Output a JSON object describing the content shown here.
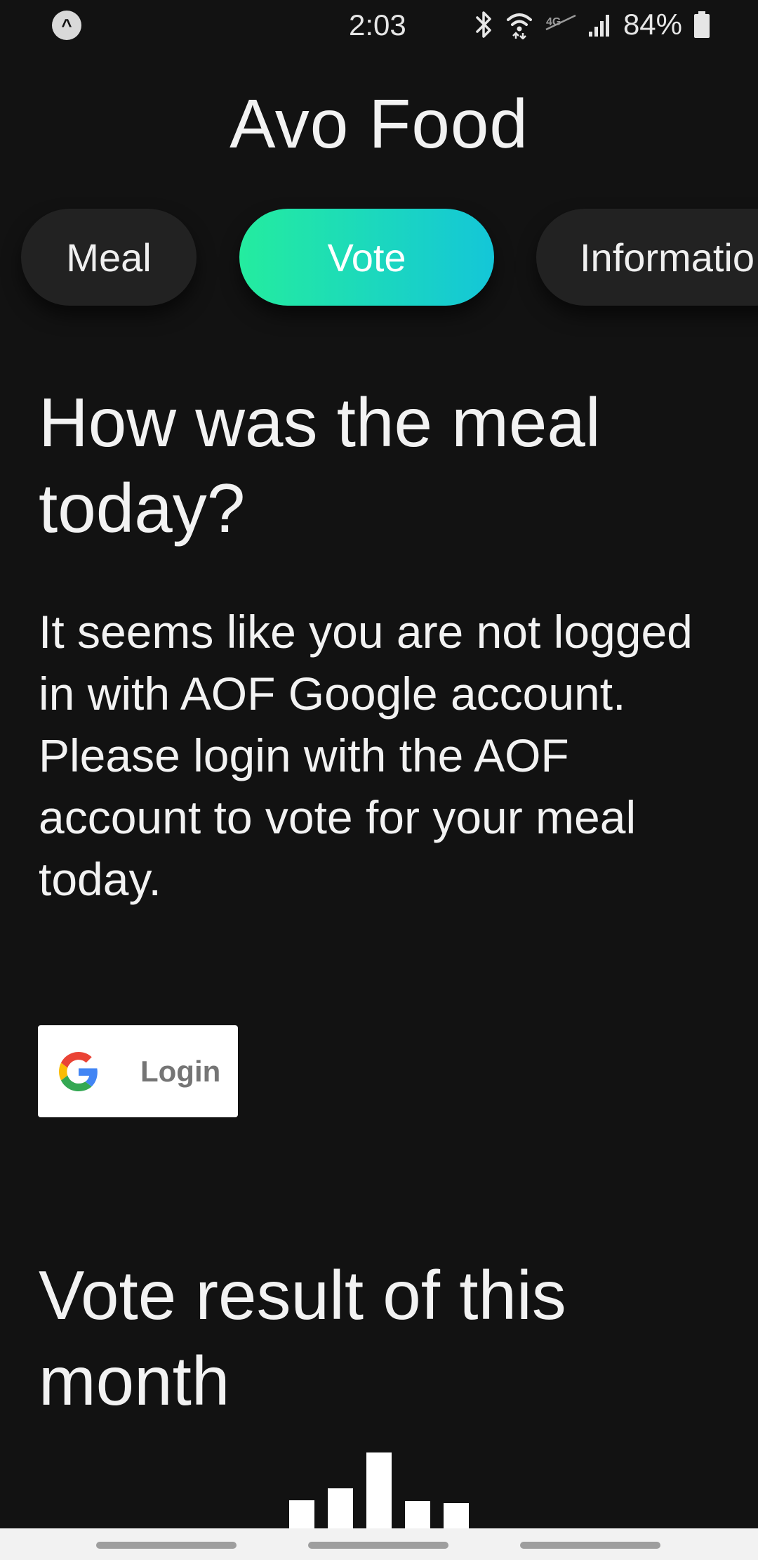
{
  "status_bar": {
    "time": "2:03",
    "battery": "84%"
  },
  "app": {
    "title": "Avo Food"
  },
  "tabs": [
    {
      "label": "Meal",
      "active": false
    },
    {
      "label": "Vote",
      "active": true
    },
    {
      "label": "Informatio",
      "active": false
    }
  ],
  "colors": {
    "background": "#121212",
    "tab_gradient_start": "#24ec9f",
    "tab_gradient_end": "#14c6d8"
  },
  "content": {
    "meal_heading": "How was the meal today?",
    "login_message_line1": "It seems like you are not logged in with AOF Google account.",
    "login_message_line2": "Please login with the AOF account to vote for your meal today.",
    "login_button_label": "Login",
    "vote_heading": "Vote result of this month"
  },
  "icons": {
    "status_app": "app-launcher-icon",
    "bluetooth": "bluetooth-icon",
    "wifi": "wifi-icon",
    "signal": "signal-icon",
    "battery": "battery-icon",
    "google": "google-icon"
  }
}
